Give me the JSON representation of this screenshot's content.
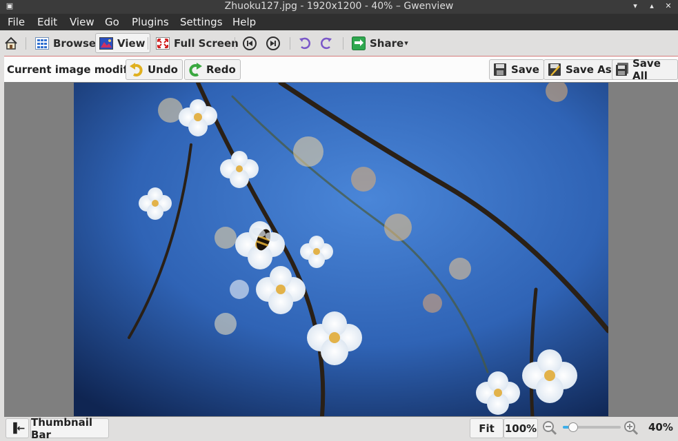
{
  "window": {
    "title": "Zhuoku127.jpg - 1920x1200 - 40% – Gwenview",
    "menu_glyph": "▣",
    "minimize": "▾",
    "maximize": "▴",
    "close": "✕"
  },
  "menu": {
    "items": [
      {
        "label": "File"
      },
      {
        "label": "Edit"
      },
      {
        "label": "View"
      },
      {
        "label": "Go"
      },
      {
        "label": "Plugins"
      },
      {
        "label": "Settings"
      },
      {
        "label": "Help"
      }
    ]
  },
  "toolbar": {
    "home_icon": "home-icon",
    "browse_label": "Browse",
    "view_label": "View",
    "fullscreen_label": "Full Screen",
    "share_label": "Share",
    "share_arrow": "▾",
    "icons": [
      "previous-icon",
      "next-icon",
      "rotate-left-icon",
      "rotate-right-icon"
    ]
  },
  "editbar": {
    "message": "Current image modified",
    "undo_label": "Undo",
    "redo_label": "Redo",
    "save_label": "Save",
    "save_as_label": "Save As",
    "save_all_label": "Save All"
  },
  "statusbar": {
    "toggle_glyph": "▐←",
    "thumbnail_bar_label": "Thumbnail Bar",
    "fit_label": "Fit",
    "hundred_label": "100%",
    "zoom_percent": "40%",
    "zoom_level": 0.12
  },
  "image": {
    "filename": "Zhuoku127.jpg",
    "subject": "plum blossoms with bee on branch",
    "background_color": "#2f63b5"
  },
  "colors": {
    "accent": "#3daee9",
    "titlebar": "#3b3b3b",
    "menubar": "#2f2f2f",
    "editbar_border": "#d47a7a"
  }
}
